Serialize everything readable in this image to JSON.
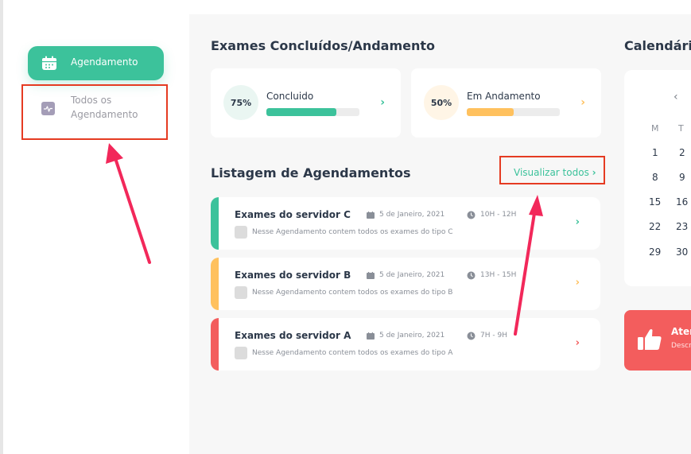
{
  "sidebar": {
    "items": [
      {
        "label": "Agendamento",
        "active": true
      },
      {
        "label": "Todos os Agendamento",
        "active": false
      }
    ]
  },
  "stats": {
    "title": "Exames Concluídos/Andamento",
    "cards": [
      {
        "percent_label": "75%",
        "label": "Concluido",
        "progress": 0.75,
        "color": "#3cc29b"
      },
      {
        "percent_label": "50%",
        "label": "Em Andamento",
        "progress": 0.5,
        "color": "#ffc15e"
      }
    ]
  },
  "list": {
    "title": "Listagem de Agendamentos",
    "view_all_label": "Visualizar todos",
    "rows": [
      {
        "title": "Exames do servidor C",
        "date": "5 de Janeiro, 2021",
        "time": "10H - 12H",
        "desc": "Nesse Agendamento contem todos os exames do tipo C",
        "color": "#3cc29b"
      },
      {
        "title": "Exames do servidor B",
        "date": "5 de Janeiro, 2021",
        "time": "13H - 15H",
        "desc": "Nesse Agendamento contem todos os exames do tipo B",
        "color": "#ffc15e"
      },
      {
        "title": "Exames do servidor A",
        "date": "5 de Janeiro, 2021",
        "time": "7H - 9H",
        "desc": "Nesse Agendamento contem todos os exames do tipo A",
        "color": "#f35d5d"
      }
    ]
  },
  "calendar": {
    "title": "Calendári",
    "day_headers": [
      "M",
      "T"
    ],
    "weeks": [
      [
        "1",
        "2"
      ],
      [
        "8",
        "9"
      ],
      [
        "15",
        "16"
      ],
      [
        "22",
        "23"
      ],
      [
        "29",
        "30"
      ]
    ]
  },
  "attention": {
    "title": "Ater",
    "subtitle": "Descr"
  },
  "colors": {
    "accent": "#3cc29b",
    "warning": "#ffc15e",
    "danger": "#f35d5d",
    "highlight": "#e53b22",
    "annotation_arrow": "#f2285a"
  }
}
